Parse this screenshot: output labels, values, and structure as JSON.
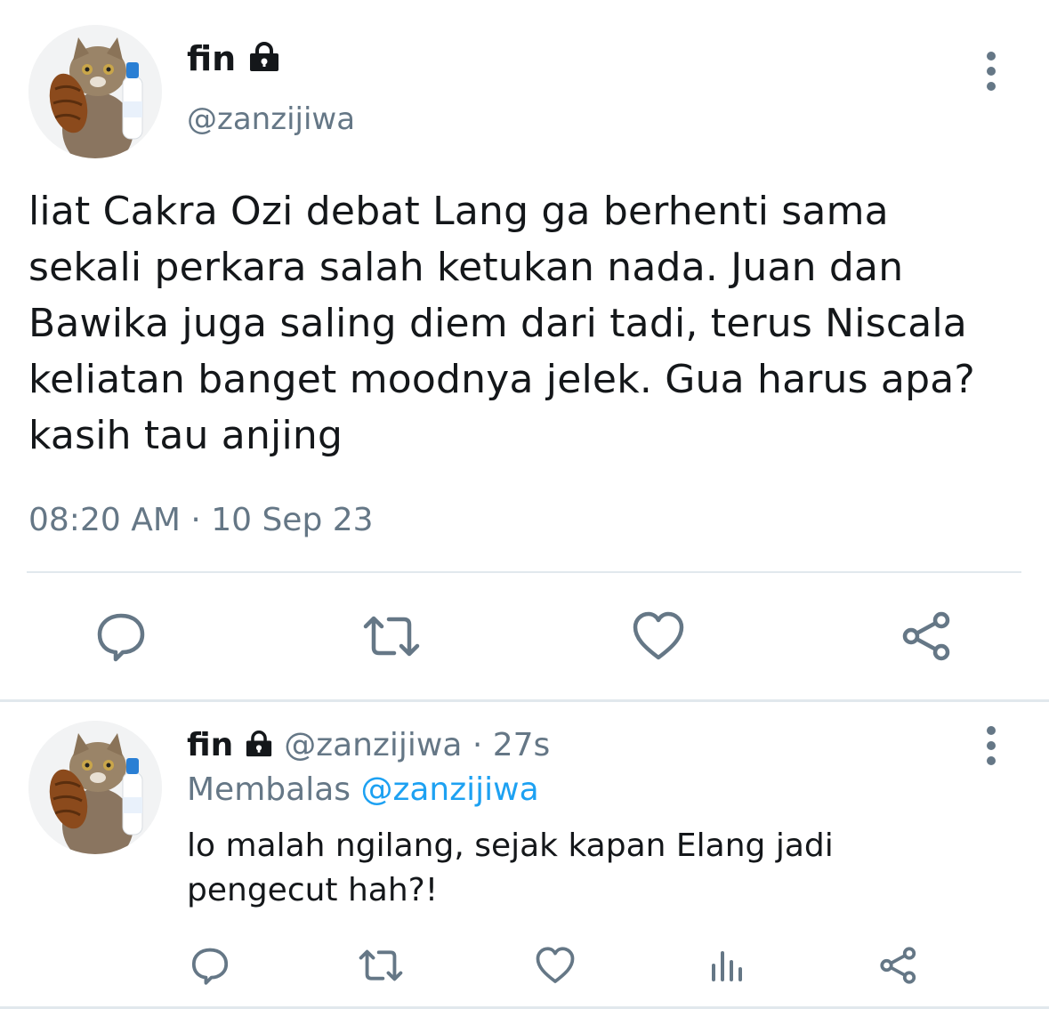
{
  "main_tweet": {
    "display_name": "fin",
    "handle": "@zanzijiwa",
    "text_lines": [
      "liat Cakra Ozi debat Lang ga berhenti sama",
      "sekali perkara salah ketukan nada. Juan dan",
      "Bawika juga saling diem dari tadi, terus Niscala",
      "keliatan banget moodnya jelek. Gua harus apa?",
      "kasih tau anjing"
    ],
    "timestamp": "08:20 AM · 10 Sep 23",
    "actions": [
      "reply-icon",
      "retweet-icon",
      "like-icon",
      "share-icon"
    ]
  },
  "reply_tweet": {
    "display_name": "fin",
    "handle_time": "@zanzijiwa · 27s",
    "replying_prefix": "Membalas",
    "replying_to": "@zanzijiwa",
    "text_lines": [
      "lo malah ngilang, sejak kapan Elang jadi",
      "pengecut hah?!"
    ],
    "actions": [
      "reply-icon",
      "retweet-icon",
      "like-icon",
      "analytics-icon",
      "share-icon"
    ]
  },
  "colors": {
    "text": "#14171a",
    "muted": "#657786",
    "link": "#1da1f2",
    "divider": "#e1e8ed"
  }
}
